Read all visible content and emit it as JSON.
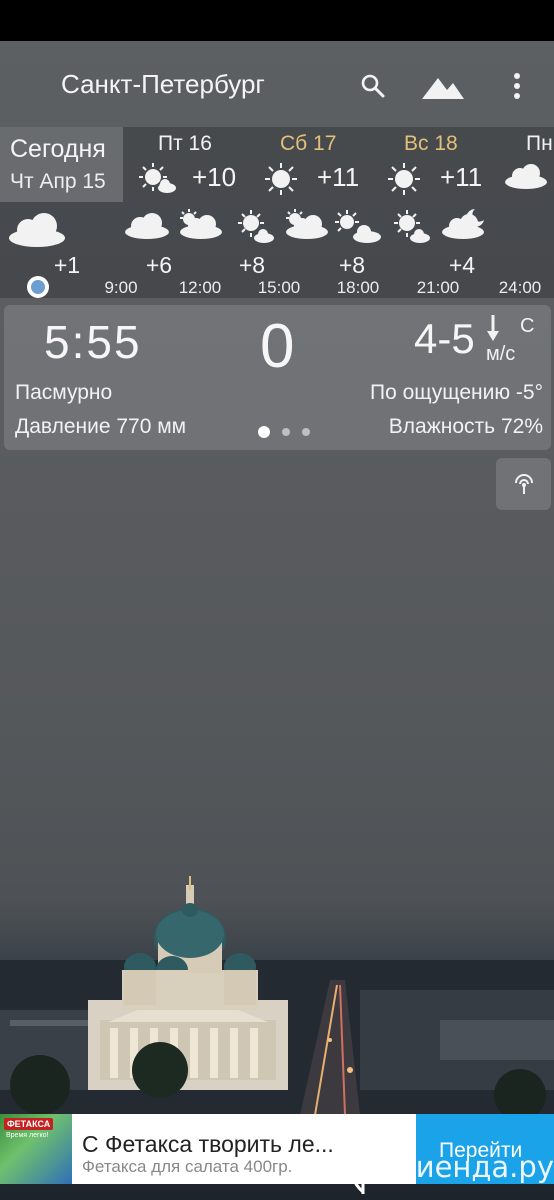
{
  "toolbar": {
    "city": "Санкт-Петербург",
    "icons": [
      "search-icon",
      "mountain-icon",
      "more-vert-icon"
    ]
  },
  "days": {
    "today": {
      "label": "Сегодня",
      "date": "Чт Апр 15"
    },
    "items": [
      {
        "label": "Пт 16",
        "temp": "+10",
        "icon": "sun-cloud-icon",
        "weekend": false
      },
      {
        "label": "Сб 17",
        "temp": "+11",
        "icon": "sun-icon",
        "weekend": true
      },
      {
        "label": "Вс 18",
        "temp": "+11",
        "icon": "sun-icon",
        "weekend": true
      },
      {
        "label": "Пн",
        "temp": "",
        "icon": "cloud-icon",
        "weekend": false
      }
    ]
  },
  "hourly": [
    {
      "temp": "+1",
      "time": "",
      "icon": "cloud-icon"
    },
    {
      "temp": "+6",
      "time": "9:00",
      "icon": "cloud-icon"
    },
    {
      "temp": "",
      "time": "12:00",
      "icon": "sun-cloud-icon"
    },
    {
      "temp": "+8",
      "time": "15:00",
      "icon": "sun-cloud-icon"
    },
    {
      "temp": "",
      "time": "18:00",
      "icon": "sun-cloud-icon"
    },
    {
      "temp": "+8",
      "time": "",
      "icon": "sun-cloud-icon"
    },
    {
      "temp": "",
      "time": "21:00",
      "icon": "sun-cloud-icon"
    },
    {
      "temp": "+4",
      "time": "",
      "icon": "moon-cloud-icon"
    },
    {
      "temp": "",
      "time": "24:00",
      "icon": ""
    }
  ],
  "current": {
    "time": "5:55",
    "temp": "0",
    "wind": "4-5",
    "wind_dir": "С",
    "wind_unit": "м/с",
    "condition": "Пасмурно",
    "feels_like": "По ощущению -5°",
    "pressure": "Давление 770 мм",
    "humidity": "Влажность 72%"
  },
  "ad": {
    "brand": "ФЕТАКСА",
    "brand_sub": "Время легко!",
    "headline": "С Фетакса творить ле...",
    "description": "Фетакса для салата 400гр.",
    "cta": "Перейти"
  },
  "watermark": "асиенда.ру",
  "colors": {
    "weekend": "#e3c07a",
    "cta": "#1aa3e8",
    "current_dot": "#6b9fd0"
  }
}
